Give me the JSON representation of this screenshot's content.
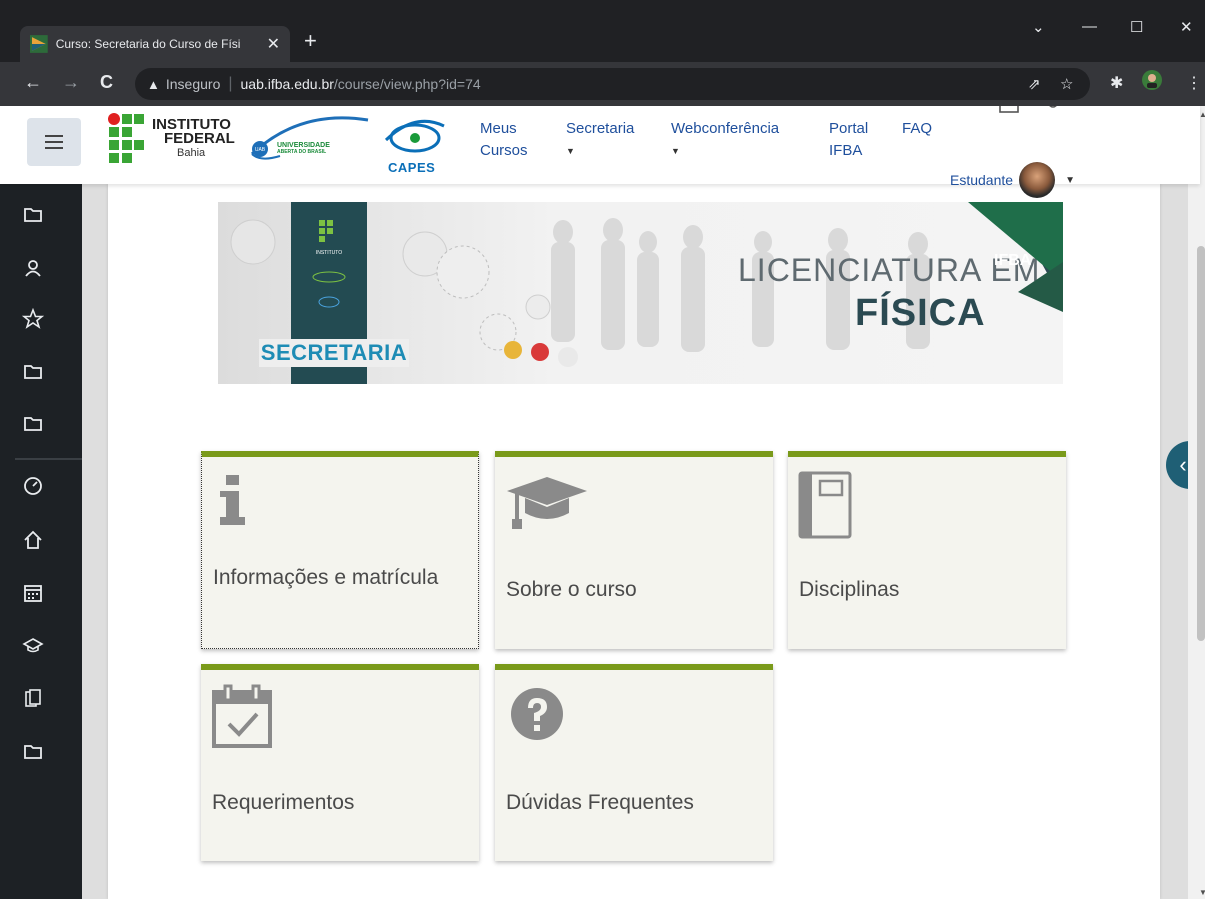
{
  "browser": {
    "tab_title": "Curso: Secretaria do Curso de Físi",
    "tab_close": "✕",
    "new_tab": "+",
    "insecure_label": "Inseguro",
    "url_host": "uab.ifba.edu.br",
    "url_path": "/course/view.php?id=74",
    "win_min": "—",
    "win_max": "☐",
    "win_close": "✕",
    "tab_list": "⌄"
  },
  "navbar": {
    "logos": {
      "if_line1": "INSTITUTO",
      "if_line2": "FEDERAL",
      "if_line3": "Bahia",
      "uab_line1": "UNIVERSIDADE",
      "uab_line2": "ABERTA DO BRASIL",
      "uab_small": "UAB",
      "capes": "CAPES"
    },
    "menu": [
      {
        "line1": "Meus",
        "line2": "Cursos"
      },
      {
        "line1": "Secretaria",
        "line2": "▼"
      },
      {
        "line1": "Webconferência",
        "line2": "▼"
      },
      {
        "line1": "Portal",
        "line2": "IFBA"
      },
      {
        "line1": "FAQ",
        "line2": ""
      }
    ],
    "user_name": "Estudante"
  },
  "banner": {
    "secretaria": "SECRETARIA",
    "licenciatura": "LICENCIATURA EM",
    "fisica": "FÍSICA",
    "ifba": "IFBA"
  },
  "tiles": [
    {
      "label": "Informações e matrícula",
      "icon": "info-icon"
    },
    {
      "label": "Sobre o curso",
      "icon": "graduation-cap-icon"
    },
    {
      "label": "Disciplinas",
      "icon": "notebook-icon"
    },
    {
      "label": "Requerimentos",
      "icon": "calendar-check-icon"
    },
    {
      "label": "Dúvidas Frequentes",
      "icon": "question-circle-icon"
    }
  ],
  "colors": {
    "tile_accent": "#7a9a1a",
    "tile_bg": "#f4f4ee",
    "drawer_bg": "#1d2125",
    "link": "#1f4f9c"
  }
}
